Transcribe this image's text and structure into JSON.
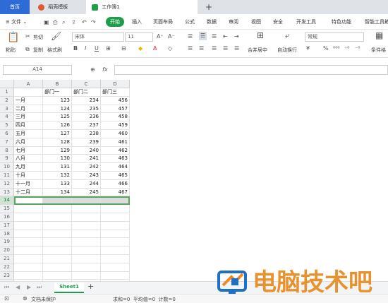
{
  "tabs": {
    "home": "首页",
    "template": "稻壳模板",
    "workbook": "工作簿1",
    "new_tab": "+"
  },
  "menu": {
    "file": "文件",
    "items": [
      "开始",
      "插入",
      "页面布局",
      "公式",
      "数据",
      "审阅",
      "视图",
      "安全",
      "开发工具",
      "特色功能",
      "智能工具箱"
    ]
  },
  "ribbon": {
    "paste": "粘贴",
    "cut": "剪切",
    "copy": "复制",
    "format_painter": "格式刷",
    "font_name": "宋体",
    "font_size": "11",
    "merge_center": "合并居中",
    "wrap_text": "自动换行",
    "number_format": "常规",
    "conditional_format": "条件格"
  },
  "formula_bar": {
    "cell_ref": "A14",
    "fx": "fx",
    "value": ""
  },
  "sheet": {
    "columns": [
      "A",
      "B",
      "C",
      "D"
    ],
    "rows": [
      [
        "",
        "部门一",
        "部门二",
        "部门三"
      ],
      [
        "一月",
        "123",
        "234",
        "456"
      ],
      [
        "二月",
        "124",
        "235",
        "457"
      ],
      [
        "三月",
        "125",
        "236",
        "458"
      ],
      [
        "四月",
        "126",
        "237",
        "459"
      ],
      [
        "五月",
        "127",
        "238",
        "460"
      ],
      [
        "六月",
        "128",
        "239",
        "461"
      ],
      [
        "七月",
        "129",
        "240",
        "462"
      ],
      [
        "八月",
        "130",
        "241",
        "463"
      ],
      [
        "九月",
        "131",
        "242",
        "464"
      ],
      [
        "十月",
        "132",
        "243",
        "465"
      ],
      [
        "十一月",
        "133",
        "244",
        "466"
      ],
      [
        "十二月",
        "134",
        "245",
        "467"
      ]
    ],
    "row_numbers": [
      "1",
      "2",
      "3",
      "4",
      "5",
      "6",
      "7",
      "8",
      "9",
      "10",
      "11",
      "12",
      "13",
      "14",
      "15",
      "16",
      "17",
      "18",
      "19",
      "20",
      "21",
      "22",
      "23",
      "24"
    ],
    "selected_row": "14",
    "sheet_tab": "Sheet1",
    "add_sheet": "+"
  },
  "status": {
    "doc_protect": "文档未保护",
    "summary": "求和=0  平均值=0  计数=0"
  },
  "watermark": {
    "text": "电脑技术吧"
  },
  "colors": {
    "tab_bar": "#dfe3e8",
    "accent_green": "#1e9e4a",
    "selection": "#5aa462",
    "watermark_blue": "#1f6fc5",
    "watermark_orange": "#f08a24"
  }
}
